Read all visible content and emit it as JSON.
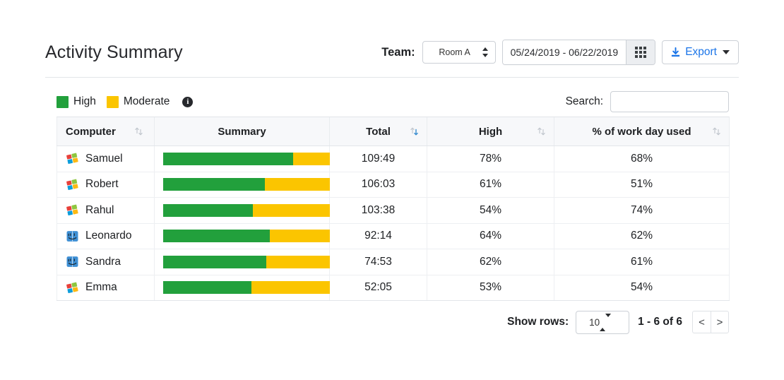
{
  "header": {
    "title": "Activity Summary",
    "team_label": "Team:",
    "team_value": "Room A",
    "date_range": "05/24/2019 - 06/22/2019",
    "calendar_icon": "grid-calendar-icon",
    "export_label": "Export",
    "export_icon": "download-icon",
    "export_caret_icon": "caret-down-icon"
  },
  "legend": {
    "items": [
      {
        "label": "High",
        "color": "#22a03c"
      },
      {
        "label": "Moderate",
        "color": "#fbc500"
      }
    ],
    "info_icon": "info-icon",
    "info_glyph": "i"
  },
  "search": {
    "label": "Search:",
    "value": "",
    "placeholder": ""
  },
  "table": {
    "columns": [
      {
        "label": "Computer",
        "sort": "none",
        "align": "left"
      },
      {
        "label": "Summary",
        "sort": "none",
        "align": "center"
      },
      {
        "label": "Total",
        "sort": "desc",
        "align": "center"
      },
      {
        "label": "High",
        "sort": "none",
        "align": "center"
      },
      {
        "label": "% of work day used",
        "sort": "none",
        "align": "center"
      }
    ],
    "rows": [
      {
        "os": "windows",
        "name": "Samuel",
        "total": "109:49",
        "high": "78%",
        "work_day": "68%",
        "high_pct": 78
      },
      {
        "os": "windows",
        "name": "Robert",
        "total": "106:03",
        "high": "61%",
        "work_day": "51%",
        "high_pct": 61
      },
      {
        "os": "windows",
        "name": "Rahul",
        "total": "103:38",
        "high": "54%",
        "work_day": "74%",
        "high_pct": 54
      },
      {
        "os": "mac",
        "name": "Leonardo",
        "total": "92:14",
        "high": "64%",
        "work_day": "62%",
        "high_pct": 64
      },
      {
        "os": "mac",
        "name": "Sandra",
        "total": "74:53",
        "high": "62%",
        "work_day": "61%",
        "high_pct": 62
      },
      {
        "os": "windows",
        "name": "Emma",
        "total": "52:05",
        "high": "53%",
        "work_day": "54%",
        "high_pct": 53
      }
    ]
  },
  "footer": {
    "show_rows_label": "Show rows:",
    "rows_per_page": "10",
    "range_text": "1 - 6 of 6",
    "prev_label": "<",
    "next_label": ">"
  },
  "colors": {
    "high": "#22a03c",
    "moderate": "#fbc500",
    "link": "#1b75e8",
    "header_bg": "#f7f8fa",
    "border": "#e2e5e9"
  },
  "chart_data": {
    "type": "bar",
    "title": "Activity Summary",
    "categories": [
      "Samuel",
      "Robert",
      "Rahul",
      "Leonardo",
      "Sandra",
      "Emma"
    ],
    "series": [
      {
        "name": "High",
        "values": [
          78,
          61,
          54,
          64,
          62,
          53
        ],
        "color": "#22a03c"
      },
      {
        "name": "Moderate",
        "values": [
          22,
          39,
          46,
          36,
          38,
          47
        ],
        "color": "#fbc500"
      }
    ],
    "stacked": true,
    "ylim": [
      0,
      100
    ],
    "ylabel": "",
    "xlabel": "",
    "grid": false,
    "legend_position": "top-left"
  }
}
